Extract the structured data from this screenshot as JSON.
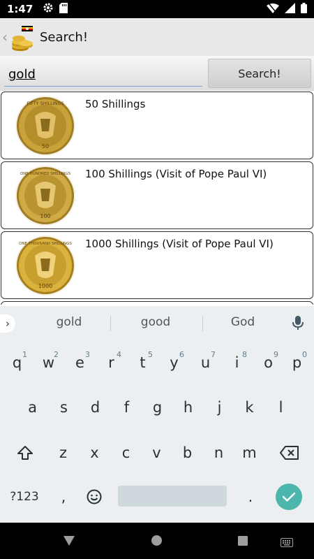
{
  "status_bar": {
    "time": "1:47",
    "icons": [
      "gear-icon",
      "sd-card-icon",
      "wifi-icon",
      "signal-icon",
      "battery-icon"
    ]
  },
  "action_bar": {
    "title": "Search!",
    "up_icon": "chevron-left-icon",
    "logo_icon": "flag-and-coins-icon"
  },
  "search": {
    "query": "gold",
    "button_label": "Search!"
  },
  "results": [
    {
      "label": "50 Shillings",
      "coin_top_text": "FIFTY SHILLINGS",
      "coin_value": "50"
    },
    {
      "label": "100 Shillings (Visit of Pope Paul VI)",
      "coin_top_text": "ONE HUNDRED SHILLINGS",
      "coin_value": "100"
    },
    {
      "label": "1000 Shillings (Visit of Pope Paul VI)",
      "coin_top_text": "ONE THOUSAND SHILLINGS",
      "coin_value": "1000"
    }
  ],
  "keyboard": {
    "suggestions": [
      "gold",
      "good",
      "God"
    ],
    "row1": [
      "q",
      "w",
      "e",
      "r",
      "t",
      "y",
      "u",
      "i",
      "o",
      "p"
    ],
    "row1_hints": [
      "1",
      "2",
      "3",
      "4",
      "5",
      "6",
      "7",
      "8",
      "9",
      "0"
    ],
    "row2": [
      "a",
      "s",
      "d",
      "f",
      "g",
      "h",
      "j",
      "k",
      "l"
    ],
    "row3": [
      "z",
      "x",
      "c",
      "v",
      "b",
      "n",
      "m"
    ],
    "symbols_label": "?123",
    "comma": ",",
    "period": "."
  },
  "colors": {
    "accent": "#4db6ac",
    "keyboard_bg": "#eceff1",
    "action_bar_bg": "#e8e8e8",
    "gold": "#c9a23a"
  }
}
